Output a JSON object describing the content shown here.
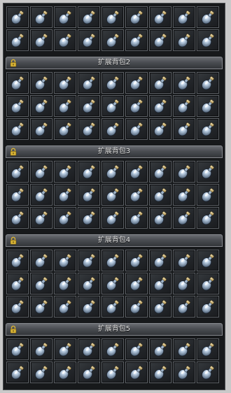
{
  "inventory": {
    "columns": 9,
    "item_icon": "empty-potion-bottle-icon",
    "sections": [
      {
        "id": "base",
        "label": "",
        "rows": 2
      },
      {
        "id": "ext2",
        "label": "扩展背包2",
        "rows": 3,
        "lock_icon": "lock-icon"
      },
      {
        "id": "ext3",
        "label": "扩展背包3",
        "rows": 3,
        "lock_icon": "lock-icon"
      },
      {
        "id": "ext4",
        "label": "扩展背包4",
        "rows": 3,
        "lock_icon": "lock-icon"
      },
      {
        "id": "ext5",
        "label": "扩展背包5",
        "rows": 2,
        "lock_icon": "lock-icon"
      }
    ],
    "colors": {
      "slot_border": "#5b5f64",
      "header_text": "#e4e4e4",
      "lock": "#d7b235",
      "bottle_glass": "#b7cbe0"
    }
  }
}
